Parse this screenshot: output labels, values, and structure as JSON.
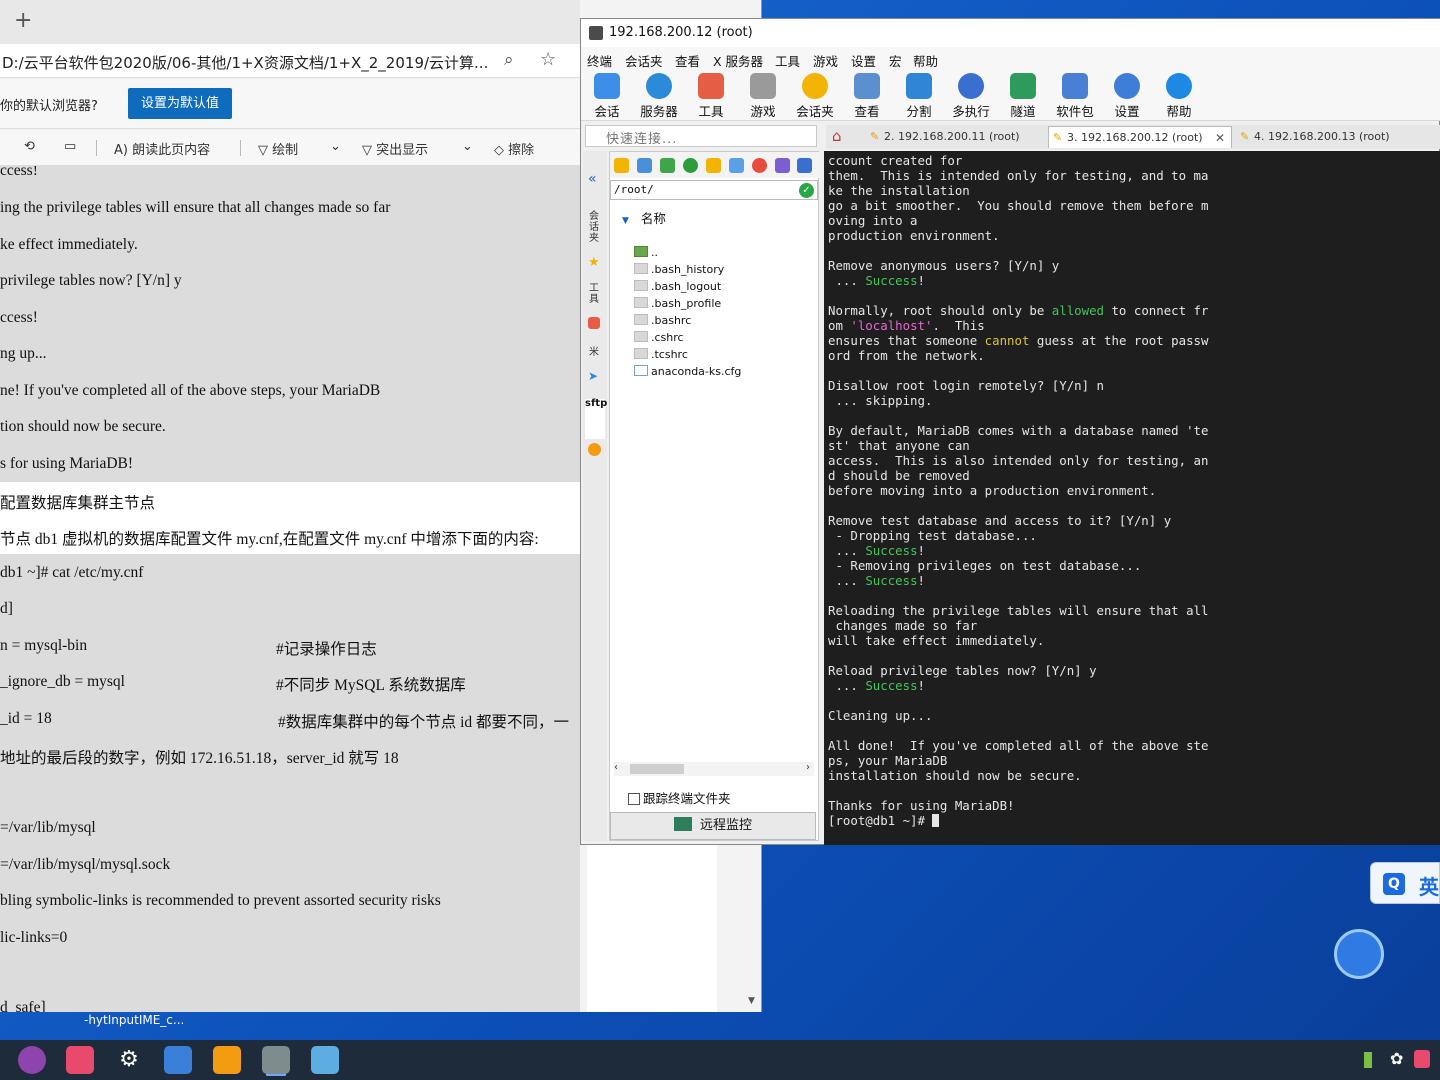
{
  "browser": {
    "new_tab": "+",
    "address": "D:/云平台软件包2020版/06-其他/1+X资源文档/1+X_2_2019/云计算...",
    "default_question": "你的默认浏览器?",
    "set_default_button": "设置为默认值",
    "toolbar": {
      "read_aloud": "朗读此页内容",
      "draw": "绘制",
      "highlight": "突出显示",
      "erase": "擦除"
    },
    "doc_lines": [
      "ccess!",
      "ing the privilege tables will ensure that all changes made so far",
      "ke effect immediately.",
      " privilege tables now? [Y/n] y",
      "ccess!",
      "ng up...",
      "ne!    If you've completed all of the above steps, your MariaDB",
      "tion should now be secure.",
      "s for using MariaDB!",
      "配置数据库集群主节点",
      "节点 db1 虚拟机的数据库配置文件 my.cnf,在配置文件 my.cnf 中增添下面的内容:",
      "db1 ~]# cat /etc/my.cnf",
      "d]",
      "n = mysql-bin",
      "_ignore_db = mysql",
      "_id = 18",
      "地址的最后段的数字，例如 172.16.51.18，server_id 就写 18",
      "=/var/lib/mysql",
      "=/var/lib/mysql/mysql.sock",
      "bling symbolic-links is recommended to prevent assorted security risks",
      "lic-links=0",
      "d_safe]"
    ],
    "doc_comments": {
      "log": "#记录操作日志",
      "ignore": "#不同步 MySQL 系统数据库",
      "id": "#数据库集群中的每个节点 id 都要不同，一"
    }
  },
  "xshell": {
    "title": "192.168.200.12 (root)",
    "menu": [
      "终端",
      "会话夹",
      "查看",
      "X 服务器",
      "工具",
      "游戏",
      "设置",
      "宏",
      "帮助"
    ],
    "tools": [
      "会话",
      "服务器",
      "工具",
      "游戏",
      "会话夹",
      "查看",
      "分割",
      "多执行",
      "隧道",
      "软件包",
      "设置",
      "帮助"
    ],
    "quick_connect": "快速连接...",
    "tabs": [
      "2. 192.168.200.11 (root)",
      "3. 192.168.200.12 (root)",
      "4. 192.168.200.13 (root)"
    ],
    "side_labels": [
      "会话夹",
      "工具",
      "米",
      "sftp"
    ],
    "sftp": {
      "path": "/root/",
      "tree_header": "名称",
      "files": [
        "..",
        ".bash_history",
        ".bash_logout",
        ".bash_profile",
        ".bashrc",
        ".cshrc",
        ".tcshrc",
        "anaconda-ks.cfg"
      ],
      "follow_terminal": "跟踪终端文件夹",
      "remote_monitor": "远程监控"
    }
  },
  "ime": {
    "q": "Q",
    "label": "英",
    "tip": "-hytInputIME_c..."
  },
  "colors": {
    "terminal_bg": "#1e1e1e",
    "success_green": "#45c45b",
    "warn_yellow": "#d9c23e",
    "string_magenta": "#e26ad0",
    "accent_blue": "#0f6cbd"
  }
}
